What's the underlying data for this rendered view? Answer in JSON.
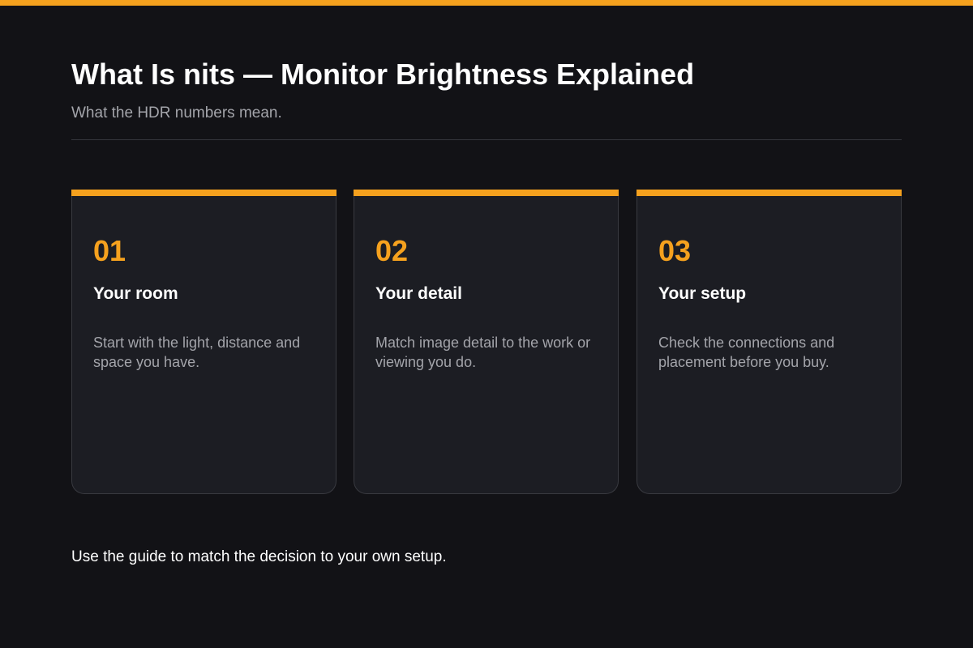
{
  "header": {
    "title": "What Is nits — Monitor Brightness Explained",
    "subtitle": "What the HDR numbers mean."
  },
  "cards": [
    {
      "number": "01",
      "heading": "Your room",
      "body": "Start with the light, distance and space you have."
    },
    {
      "number": "02",
      "heading": "Your detail",
      "body": "Match image detail to the work or viewing you do."
    },
    {
      "number": "03",
      "heading": "Your setup",
      "body": "Check the connections and placement before you buy."
    }
  ],
  "footer": {
    "text": "Use the guide to match the decision to your own setup."
  },
  "colors": {
    "background": "#121216",
    "accent": "#f5a11e",
    "card_background": "#1c1d23",
    "card_border": "#393a40",
    "text_primary": "#ffffff",
    "text_secondary": "#a3a4aa"
  }
}
